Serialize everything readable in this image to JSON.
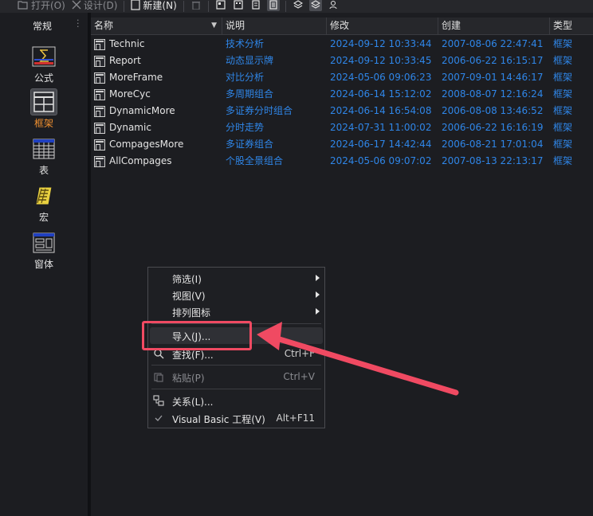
{
  "toolbar": {
    "open_label": "打开(O)",
    "design_label": "设计(D)",
    "new_label": "新建(N)"
  },
  "sidebar": {
    "title": "常规",
    "items": [
      {
        "label": "公式",
        "icon": "formula-icon"
      },
      {
        "label": "框架",
        "icon": "frame-icon",
        "active": true
      },
      {
        "label": "表",
        "icon": "table-icon"
      },
      {
        "label": "宏",
        "icon": "macro-icon"
      },
      {
        "label": "窗体",
        "icon": "form-icon"
      }
    ]
  },
  "table": {
    "columns": [
      "名称",
      "说明",
      "修改",
      "创建",
      "类型"
    ],
    "rows": [
      {
        "name": "Technic",
        "desc": "技术分析",
        "modified": "2024-09-12 10:33:44",
        "created": "2007-08-06 22:47:41",
        "type": "框架"
      },
      {
        "name": "Report",
        "desc": "动态显示牌",
        "modified": "2024-09-12 10:33:45",
        "created": "2006-06-22 16:15:17",
        "type": "框架"
      },
      {
        "name": "MoreFrame",
        "desc": "对比分析",
        "modified": "2024-05-06 09:06:23",
        "created": "2007-09-01 14:46:17",
        "type": "框架"
      },
      {
        "name": "MoreCyc",
        "desc": "多周期组合",
        "modified": "2024-06-14 15:12:02",
        "created": "2008-08-07 12:16:24",
        "type": "框架"
      },
      {
        "name": "DynamicMore",
        "desc": "多证券分时组合",
        "modified": "2024-06-14 16:54:08",
        "created": "2006-08-08 13:46:52",
        "type": "框架"
      },
      {
        "name": "Dynamic",
        "desc": "分时走势",
        "modified": "2024-07-31 11:00:02",
        "created": "2006-06-22 16:16:19",
        "type": "框架"
      },
      {
        "name": "CompagesMore",
        "desc": "多证券组合",
        "modified": "2024-06-17 14:42:44",
        "created": "2006-08-21 17:01:04",
        "type": "框架"
      },
      {
        "name": "AllCompages",
        "desc": "个股全景组合",
        "modified": "2024-05-06 09:07:02",
        "created": "2007-08-13 22:13:17",
        "type": "框架"
      }
    ]
  },
  "context_menu": {
    "filter": "筛选(I)",
    "view": "视图(V)",
    "sort_icons": "排列图标",
    "import": "导入(J)...",
    "find": "查找(F)...",
    "find_shortcut": "Ctrl+F",
    "paste": "粘贴(P)",
    "paste_shortcut": "Ctrl+V",
    "relations": "关系(L)...",
    "vb_project": "Visual Basic 工程(V)",
    "vb_shortcut": "Alt+F11"
  },
  "colors": {
    "accent_orange": "#f09030",
    "link_blue": "#2f86e8",
    "highlight_red": "#f04a62"
  }
}
